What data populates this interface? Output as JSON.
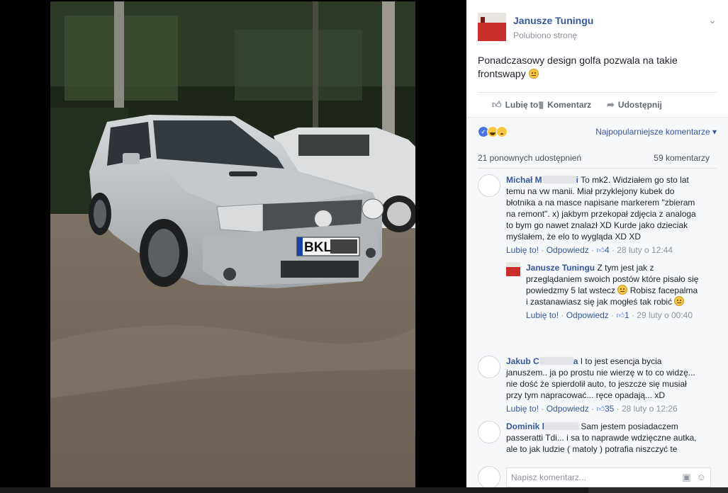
{
  "photo": {
    "plate_text": "BKL"
  },
  "post": {
    "page_name": "Janusze Tuningu",
    "page_status": "Polubiono stronę",
    "text": "Ponadczasowy design golfa pozwala na takie frontswapy"
  },
  "actions": {
    "like": "Lubię to!",
    "comment": "Komentarz",
    "share": "Udostępnij"
  },
  "stats": {
    "sort_label": "Najpopularniejsze komentarze",
    "shares": "21 ponownych udostępnień",
    "comments_count": "59 komentarzy"
  },
  "comments": [
    {
      "author": "Michał M",
      "author_tail": "i",
      "text": "To mk2. Widziałem go sto lat temu na vw manii. Miał przyklejony kubek do błotnika a na masce napisane markerem \"zbieram na remont\". x) jakbym przekopał zdjęcia z analoga to bym go nawet znalazł XD Kurde jako dzieciak myślałem, że elo to wygląda XD XD",
      "like": "Lubię to!",
      "reply": "Odpowiedz",
      "likes": "4",
      "time": "28 luty o 12:44"
    },
    {
      "author": "Jakub C",
      "author_tail": "a",
      "text": "I to jest esencja bycia januszem.. ja po prostu nie wierzę w to co widzę... nie dość że spierdolił auto, to jeszcze się musiał przy tym napracować... ręce opadają... xD",
      "like": "Lubię to!",
      "reply": "Odpowiedz",
      "likes": "35",
      "time": "28 luty o 12:26"
    },
    {
      "author": "Dominik l",
      "author_tail": "",
      "text": "Sam jestem posiadaczem passeratti Tdi... i sa to naprawde wdzięczne autka, ale to jak ludzie ( matoly ) potrafia niszczyć te"
    }
  ],
  "reply": {
    "author": "Janusze Tuningu",
    "text_a": "Z tym jest jak z przeglądaniem swoich postów które pisało się powiedzmy 5 lat wstecz",
    "text_b": "Robisz facepalma i zastanawiasz się jak mogłeś tak robić",
    "like": "Lubię to!",
    "reply": "Odpowiedz",
    "likes": "1",
    "time": "29 luty o 00:40"
  },
  "composer": {
    "placeholder": "Napisz komentarz..."
  },
  "icons": {
    "like": "thumbs-up-icon",
    "comment": "speech-bubble-icon",
    "share": "share-arrow-icon",
    "camera": "camera-icon",
    "emoji": "smiley-icon",
    "chevron": "chevron-down-icon"
  },
  "colors": {
    "link": "#365899",
    "meta": "#90949c",
    "panel_bg": "#f6f7f9",
    "like_blue": "#4a76e4"
  }
}
